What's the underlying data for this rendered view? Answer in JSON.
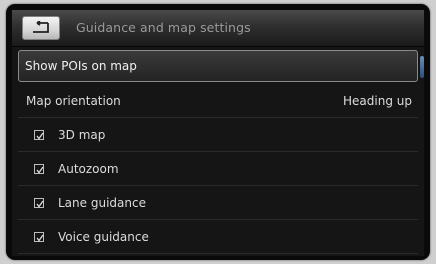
{
  "header": {
    "title": "Guidance and map settings",
    "back_icon": "back-arrow-icon"
  },
  "list": {
    "items": [
      {
        "label": "Show POIs on map",
        "selected": true
      },
      {
        "label": "Map orientation",
        "value": "Heading up"
      },
      {
        "label": "3D map",
        "checkbox": true
      },
      {
        "label": "Autozoom",
        "checkbox": true
      },
      {
        "label": "Lane guidance",
        "checkbox": true
      },
      {
        "label": "Voice guidance",
        "checkbox": true
      }
    ]
  },
  "colors": {
    "background": "#151515",
    "text": "#dcdcdc",
    "title": "#9a9a9a",
    "selection_border": "#8a8a8a",
    "scrollbar": "#4a78a8"
  }
}
